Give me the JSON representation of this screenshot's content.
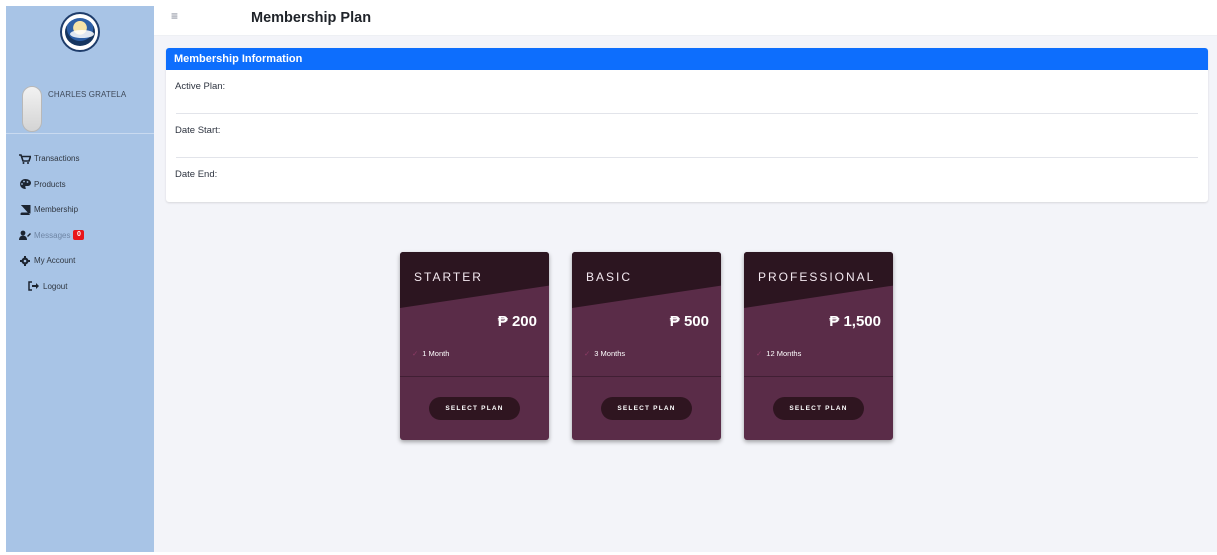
{
  "sidebar": {
    "user_name": "CHARLES GRATELA",
    "items": [
      {
        "label": "Transactions",
        "icon": "cart-icon"
      },
      {
        "label": "Products",
        "icon": "palette-icon"
      },
      {
        "label": "Membership",
        "icon": "book-icon"
      },
      {
        "label": "Messages",
        "icon": "user-edit-icon",
        "badge": "0"
      },
      {
        "label": "My Account",
        "icon": "gear-icon"
      },
      {
        "label": "Logout",
        "icon": "logout-icon"
      }
    ]
  },
  "header": {
    "menu_icon": "≡",
    "title": "Membership Plan"
  },
  "membership_info": {
    "title": "Membership Information",
    "active_plan_label": "Active Plan:",
    "date_start_label": "Date Start:",
    "date_end_label": "Date End:"
  },
  "plans": [
    {
      "name": "STARTER",
      "price": "₱ 200",
      "duration": "1 Month",
      "button": "SELECT PLAN"
    },
    {
      "name": "BASIC",
      "price": "₱ 500",
      "duration": "3 Months",
      "button": "SELECT PLAN"
    },
    {
      "name": "PROFESSIONAL",
      "price": "₱ 1,500",
      "duration": "12 Months",
      "button": "SELECT PLAN"
    }
  ],
  "colors": {
    "sidebar": "#a8c4e6",
    "header_accent": "#0d6efd",
    "plan_card": "#5a2c48",
    "plan_head": "#2c1520",
    "badge": "#e8151a"
  }
}
